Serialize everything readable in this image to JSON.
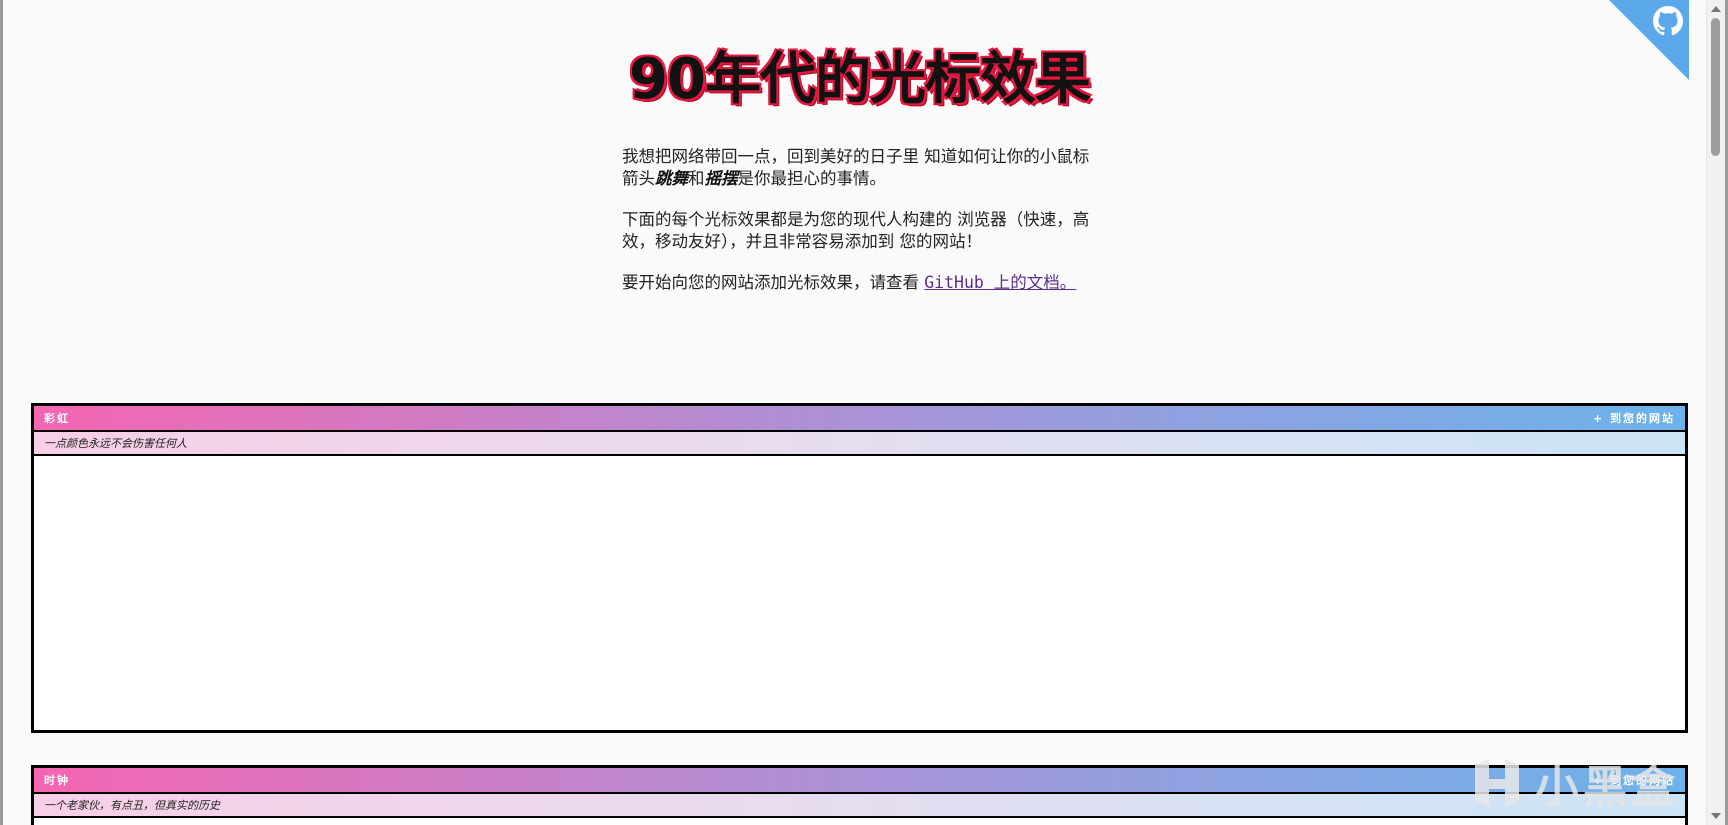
{
  "hero": {
    "title": "90年代的光标效果",
    "p1_before": "我想把网络带回一点，回到美好的日子里 知道如何让你的小鼠标箭头",
    "p1_em1": "跳舞",
    "p1_mid": "和",
    "p1_em2": "摇摆",
    "p1_after": "是你最担心的事情。",
    "p2": "下面的每个光标效果都是为您的现代人构建的 浏览器（快速，高效，移动友好），并且非常容易添加到 您的网站！",
    "p3_before": "要开始向您的网站添加光标效果，请查看 ",
    "p3_link": "GitHub 上的文档。"
  },
  "effects": [
    {
      "name": "彩虹",
      "action": "+ 到您的网站",
      "description": "一点颜色永远不会伤害任何人"
    },
    {
      "name": "时钟",
      "action": "+ 到您的网站",
      "description": "一个老家伙，有点丑，但真实的历史"
    }
  ],
  "watermark": {
    "text": "小黑盒"
  },
  "icons": {
    "corner": "github-octocat-icon",
    "watermark_logo": "heybox-logo-icon"
  },
  "colors": {
    "title_outline": "#e8173f",
    "header_gradient_start": "#f565b2",
    "header_gradient_end": "#6db2ea",
    "corner_banner": "#5ba8ea",
    "link": "#5b2d8e"
  }
}
